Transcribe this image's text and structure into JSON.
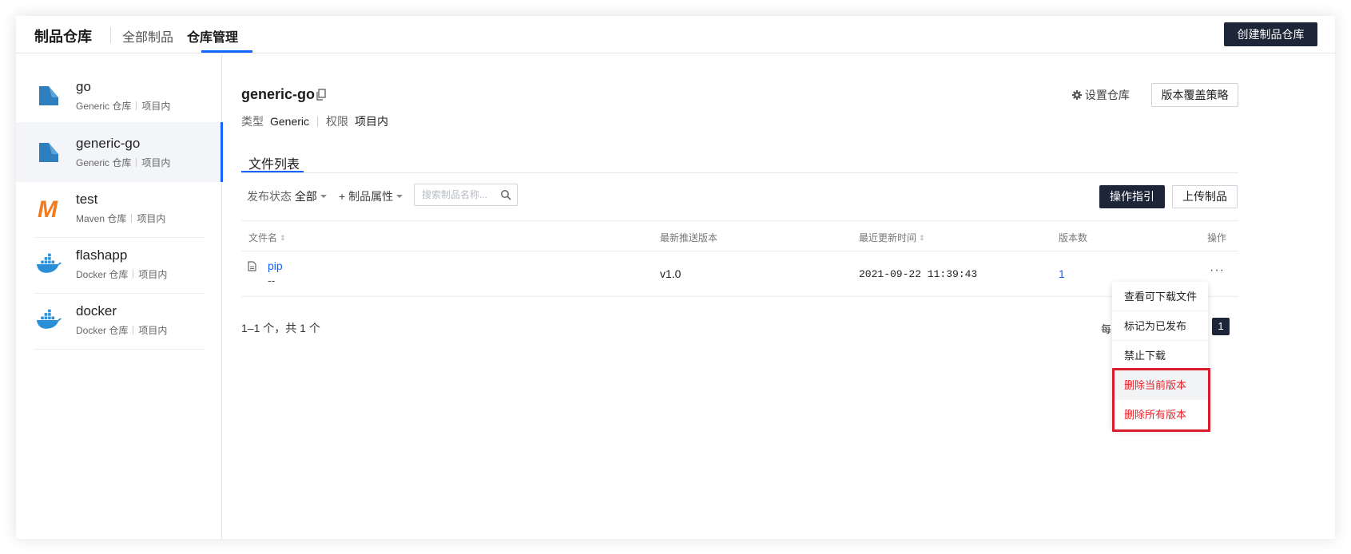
{
  "header": {
    "brand": "制品仓库",
    "tabs": [
      {
        "label": "全部制品",
        "active": false
      },
      {
        "label": "仓库管理",
        "active": true
      }
    ],
    "create_button": "创建制品仓库"
  },
  "sidebar": {
    "repos": [
      {
        "name": "go",
        "type": "Generic 仓库",
        "scope": "项目内",
        "icon": "generic-repo-icon",
        "active": false
      },
      {
        "name": "generic-go",
        "type": "Generic 仓库",
        "scope": "项目内",
        "icon": "generic-repo-icon",
        "active": true
      },
      {
        "name": "test",
        "type": "Maven 仓库",
        "scope": "项目内",
        "icon": "maven-icon",
        "active": false
      },
      {
        "name": "flashapp",
        "type": "Docker 仓库",
        "scope": "项目内",
        "icon": "docker-icon",
        "active": false
      },
      {
        "name": "docker",
        "type": "Docker 仓库",
        "scope": "项目内",
        "icon": "docker-icon",
        "active": false
      }
    ]
  },
  "repo_detail": {
    "title": "generic-go",
    "type_label": "类型",
    "type_value": "Generic",
    "perm_label": "权限",
    "perm_value": "项目内",
    "settings_link": "设置仓库",
    "policy_button": "版本覆盖策略"
  },
  "tabs": {
    "file_list": "文件列表"
  },
  "filters": {
    "status_label": "发布状态",
    "status_value": "全部",
    "attr_label": "+ 制品属性",
    "search_placeholder": "搜索制品名称...",
    "guide_button": "操作指引",
    "upload_button": "上传制品"
  },
  "table": {
    "columns": {
      "name": "文件名",
      "latest_version": "最新推送版本",
      "updated": "最近更新时间",
      "count": "版本数",
      "actions": "操作"
    },
    "rows": [
      {
        "name": "pip",
        "desc": "--",
        "latest_version": "v1.0",
        "updated": "2021-09-22 11:39:43",
        "count": "1",
        "more": "···"
      }
    ]
  },
  "pagination": {
    "summary": "1–1 个，共 1 个",
    "partial_label": "每",
    "current_page": "1"
  },
  "action_menu": {
    "items": [
      {
        "label": "查看可下载文件",
        "danger": false
      },
      {
        "label": "标记为已发布",
        "danger": false
      },
      {
        "label": "禁止下载",
        "danger": false
      },
      {
        "label": "删除当前版本",
        "danger": true
      },
      {
        "label": "删除所有版本",
        "danger": true
      }
    ]
  },
  "colors": {
    "accent": "#1664ff",
    "dark_button": "#1c2638",
    "danger": "#e5242b",
    "highlight": "#d81e2a"
  }
}
